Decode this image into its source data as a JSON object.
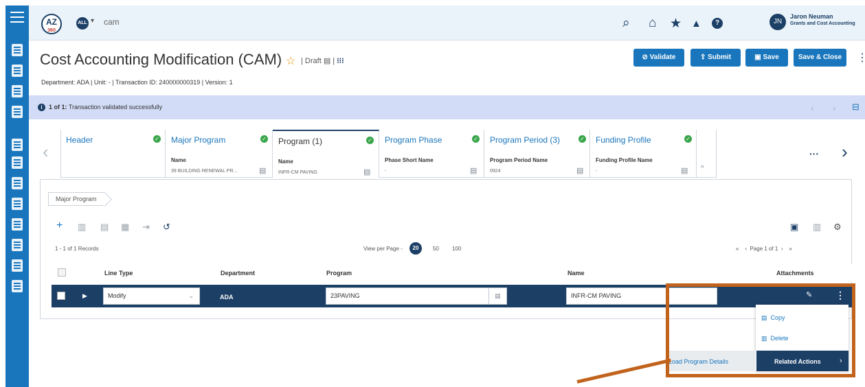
{
  "topbar": {
    "logo": "AZ",
    "logo_sub": "360",
    "context": "ALL",
    "search_value": "cam",
    "user_name": "Jaron Neuman",
    "user_role": "Grants and Cost Accounting",
    "user_initials": "JN"
  },
  "page": {
    "title": "Cost Accounting Modification (CAM)",
    "status": "Draft",
    "meta": "Department: ADA  |  Unit: -  |  Transaction ID: 240000000319  |  Version: 1"
  },
  "buttons": {
    "validate": "Validate",
    "submit": "Submit",
    "save": "Save",
    "save_close": "Save & Close"
  },
  "message": {
    "prefix": "1 of 1:",
    "text": "Transaction validated successfully"
  },
  "tabs": [
    {
      "title": "Header"
    },
    {
      "title": "Major Program",
      "field_label": "Name",
      "field_value": "39 BUILDING RENEWAL PR..."
    },
    {
      "title": "Program (1)",
      "field_label": "Name",
      "field_value": "INFR-CM PAVING"
    },
    {
      "title": "Program Phase",
      "field_label": "Phase Short Name",
      "field_value": "-"
    },
    {
      "title": "Program Period (3)",
      "field_label": "Program Period Name",
      "field_value": "0924"
    },
    {
      "title": "Funding Profile",
      "field_label": "Funding Profile Name",
      "field_value": "-"
    }
  ],
  "breadcrumb": "Major Program",
  "grid": {
    "records": "1 - 1 of 1 Records",
    "view_per_page": "View per Page -",
    "page_sizes": [
      "20",
      "50",
      "100"
    ],
    "pager": "Page 1 of 1",
    "columns": [
      "Line Type",
      "Department",
      "Program",
      "Name",
      "Attachments"
    ],
    "row": {
      "line_type": "Modify",
      "department": "ADA",
      "program": "23PAVING",
      "name": "INFR-CM PAVING"
    }
  },
  "menu": {
    "copy": "Copy",
    "delete": "Delete",
    "related_actions": "Related Actions",
    "load_program_details": "Load Program Details"
  },
  "colors": {
    "primary": "#1a76bc",
    "navy": "#1c3f66",
    "highlight": "#c1631c",
    "success": "#3aa64b",
    "message_bg": "#d2dcf6"
  }
}
